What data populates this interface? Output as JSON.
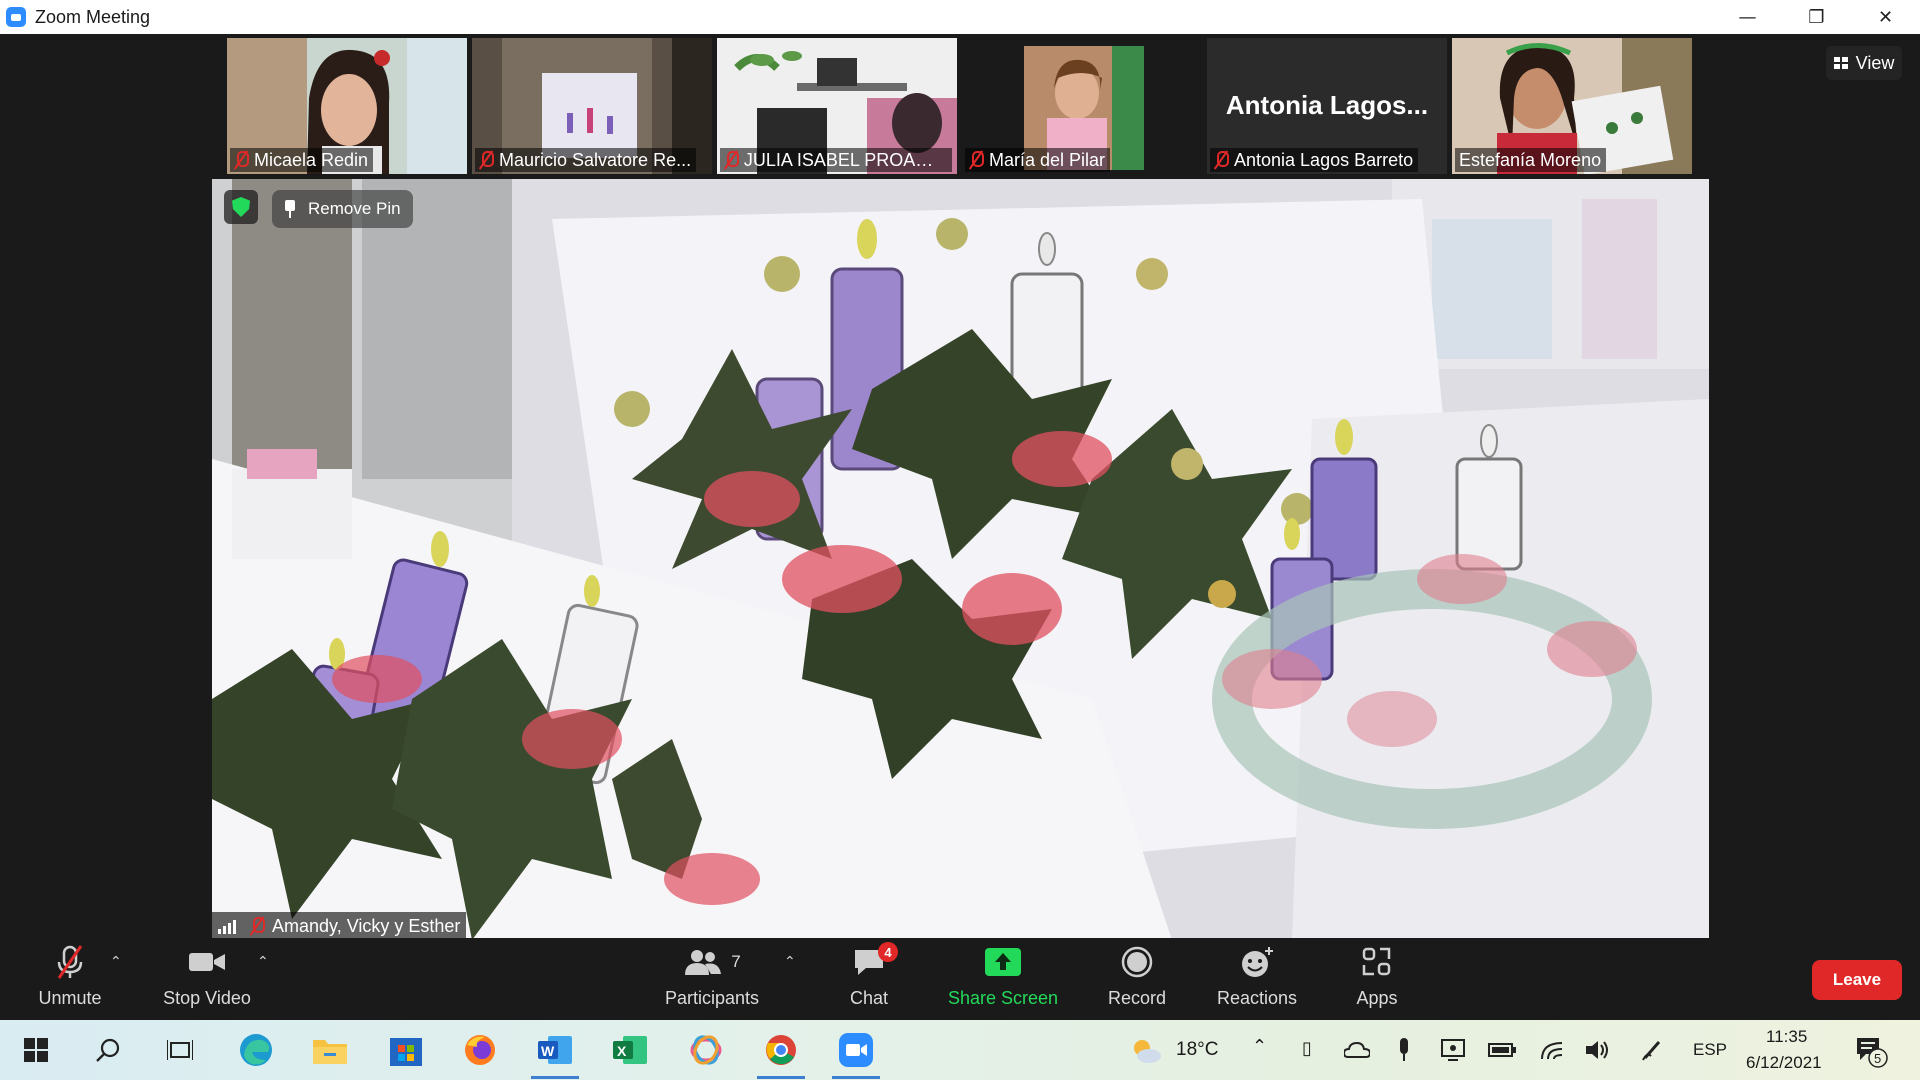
{
  "window": {
    "title": "Zoom Meeting"
  },
  "view_button": {
    "label": "View"
  },
  "participants_strip": [
    {
      "name": "Micaela Redin",
      "muted": true
    },
    {
      "name": "Mauricio Salvatore Re...",
      "muted": true
    },
    {
      "name": "JULIA ISABEL PROA�...",
      "muted": true
    },
    {
      "name": "María del Pilar",
      "muted": true
    },
    {
      "name": "Antonia Lagos Barreto",
      "muted": true,
      "video_off": true,
      "big_label": "Antonia  Lagos..."
    },
    {
      "name": "Estefanía Moreno",
      "muted": false
    }
  ],
  "main_video": {
    "remove_pin_label": "Remove Pin",
    "speaker_name": "Amandy, Vicky y Esther"
  },
  "toolbar": {
    "unmute": "Unmute",
    "stop_video": "Stop Video",
    "participants": "Participants",
    "participants_count": "7",
    "chat": "Chat",
    "chat_badge": "4",
    "share_screen": "Share Screen",
    "record": "Record",
    "reactions": "Reactions",
    "apps": "Apps",
    "leave": "Leave"
  },
  "taskbar": {
    "weather": "18°C",
    "language": "ESP",
    "time": "11:35",
    "date": "6/12/2021",
    "notification_count": "5"
  },
  "colors": {
    "zoom_blue": "#2d8cff",
    "share_green": "#23d959",
    "leave_red": "#e02828",
    "toolbar_bg": "#1a1a1a"
  }
}
